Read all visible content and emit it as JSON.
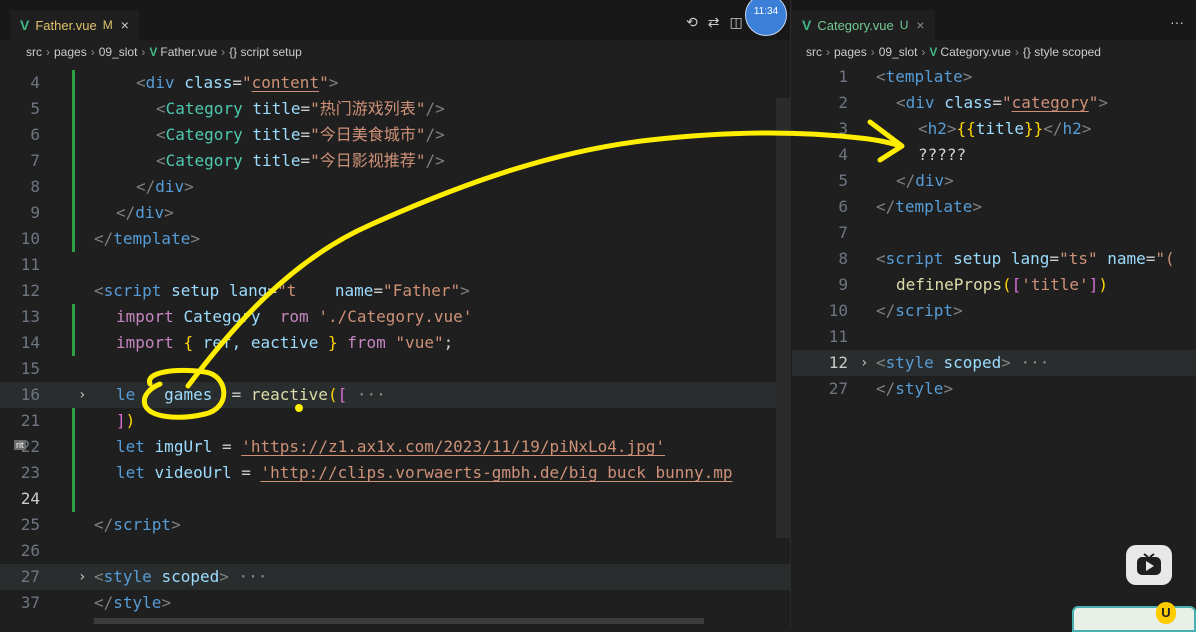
{
  "left": {
    "tab": {
      "name": "Father.vue",
      "modified": "M",
      "close": "×"
    },
    "breadcrumb": [
      "src",
      "pages",
      "09_slot",
      "Father.vue",
      "{} script setup"
    ],
    "lines": [
      {
        "n": "4"
      },
      {
        "n": "5"
      },
      {
        "n": "6"
      },
      {
        "n": "7"
      },
      {
        "n": "8"
      },
      {
        "n": "9"
      },
      {
        "n": "10"
      },
      {
        "n": "11"
      },
      {
        "n": "12"
      },
      {
        "n": "13"
      },
      {
        "n": "14"
      },
      {
        "n": "15"
      },
      {
        "n": "16"
      },
      {
        "n": "21"
      },
      {
        "n": "22"
      },
      {
        "n": "23"
      },
      {
        "n": "24"
      },
      {
        "n": "25"
      },
      {
        "n": "26"
      },
      {
        "n": "27"
      },
      {
        "n": "37"
      }
    ],
    "code": {
      "l4_class": "content",
      "cat1": "热门游戏列表",
      "cat2": "今日美食城市",
      "cat3": "今日影视推荐",
      "script_lang_vis": "t",
      "script_name": "Father",
      "import_from_vis": "rom",
      "import_path": "'./Category.vue'",
      "ref_vis": "ref,",
      "reactive_vis": "eactive",
      "vue_str": "\"vue\"",
      "let_vis": "le",
      "games": "games",
      "reactive_call": "reactive",
      "img_url": "'https://z1.ax1x.com/2023/11/19/piNxLo4.jpg'",
      "video_url": "'http://clips.vorwaerts-gmbh.de/big_buck_bunny.mp",
      "gutter_marker": "rit"
    }
  },
  "right": {
    "tab": {
      "name": "Category.vue",
      "status": "U",
      "close": "×"
    },
    "breadcrumb": [
      "src",
      "pages",
      "09_slot",
      "Category.vue",
      "{} style scoped"
    ],
    "more": "···",
    "lines": [
      {
        "n": "1"
      },
      {
        "n": "2"
      },
      {
        "n": "3"
      },
      {
        "n": "4"
      },
      {
        "n": "5"
      },
      {
        "n": "6"
      },
      {
        "n": "7"
      },
      {
        "n": "8"
      },
      {
        "n": "9"
      },
      {
        "n": "10"
      },
      {
        "n": "11"
      },
      {
        "n": "12"
      },
      {
        "n": "27"
      }
    ],
    "code": {
      "div_class": "category",
      "placeholder": "?????",
      "script_name_vis": "\"(",
      "define_props_arg": "'title'"
    }
  },
  "clock": "11:34",
  "icons": {
    "history": "history-icon",
    "compare": "compare-icon",
    "split": "split-editor-icon",
    "play": "video-player-icon",
    "badge": "u-badge-icon"
  },
  "colors": {
    "annotation": "#ffee00",
    "vue": "#41b883",
    "modified": "#e0c26b"
  }
}
